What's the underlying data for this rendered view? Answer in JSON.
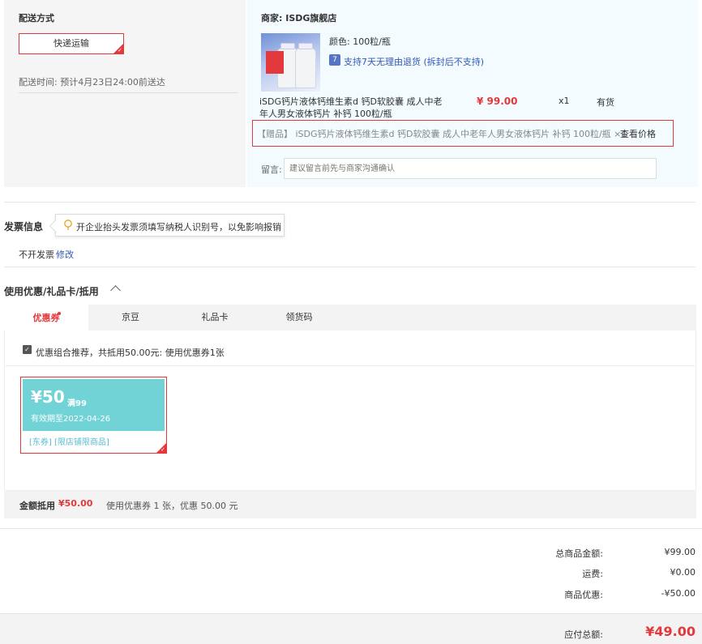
{
  "shipping": {
    "title": "配送方式",
    "method": "快递运输",
    "time_label": "配送时间:",
    "time_value": "预计4月23日24:00前送达"
  },
  "shop": {
    "name": "商家: ISDG旗舰店",
    "product": {
      "color": "颜色: 100粒/瓶",
      "return_policy": "支持7天无理由退货 (拆封后不支持)",
      "name": "iSDG钙片液体钙维生素d 钙D软胶囊 成人中老年人男女液体钙片 补钙 100粒/瓶",
      "price": "¥ 99.00",
      "qty": "x1",
      "stock": "有货"
    },
    "gift": {
      "text": "【赠品】 iSDG钙片液体钙维生素d 钙D软胶囊 成人中老年人男女液体钙片 补钙 100粒/瓶 ×1",
      "link": "查看价格"
    },
    "message": {
      "label": "留言:",
      "placeholder": "建议留言前先与商家沟通确认"
    }
  },
  "invoice": {
    "title": "发票信息",
    "tip": "开企业抬头发票须填写纳税人识别号，以免影响报销",
    "status": "不开发票",
    "edit": "修改"
  },
  "coupons": {
    "title": "使用优惠/礼品卡/抵用",
    "tabs": [
      "优惠券",
      "京豆",
      "礼品卡",
      "领货码"
    ],
    "active_tab": 0,
    "recommend_text": "优惠组合推荐，共抵用50.00元: 使用优惠券1张",
    "coupon": {
      "amount": "¥50",
      "condition": "满99",
      "expiry": "有效期至2022-04-26",
      "tags": "[东券]  [限店铺限商品]",
      "color": "#72d3d6"
    },
    "summary_label": "金额抵用",
    "summary_amount": "¥50.00",
    "summary_desc": "使用优惠券 1 张，优惠 50.00 元"
  },
  "totals": [
    {
      "label": "总商品金额:",
      "value": "¥99.00"
    },
    {
      "label": "运费:",
      "value": "¥0.00"
    },
    {
      "label": "商品优惠:",
      "value": "-¥50.00"
    }
  ],
  "payable": {
    "label": "应付总额:",
    "value": "¥49.00"
  },
  "colors": {
    "accent": "#e4393c",
    "link": "#3058b8"
  }
}
